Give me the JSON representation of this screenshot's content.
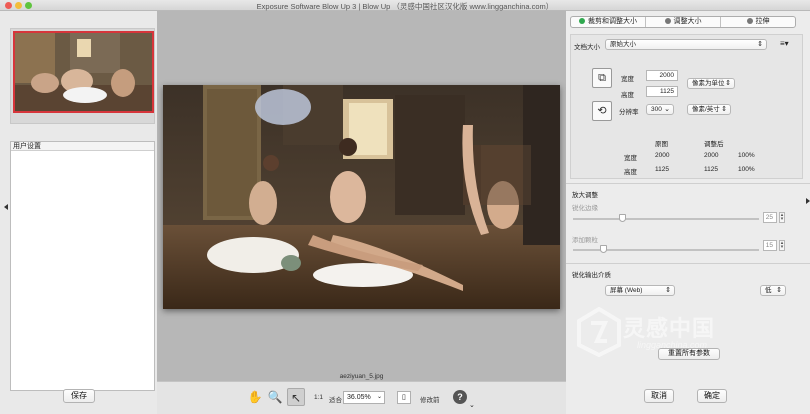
{
  "window": {
    "title": "Exposure Software Blow Up 3 | Blow Up （灵感中国社区汉化版 www.lingganchina.com）"
  },
  "left": {
    "preset_header": "用户设置",
    "save_button": "保存"
  },
  "center": {
    "filename": "aeziyuan_5.jpg",
    "zoom_one": "1:1",
    "fit_label": "适合",
    "zoom_value": "36.05%",
    "modified_label": "修改前",
    "help_label": "?"
  },
  "tabs": [
    {
      "label": "裁剪和调整大小"
    },
    {
      "label": "调整大小"
    },
    {
      "label": "拉伸"
    }
  ],
  "document": {
    "size_label": "文档大小",
    "size_value": "原始大小",
    "width_label": "宽度",
    "width_value": "2000",
    "height_label": "高度",
    "height_value": "1125",
    "unit_value": "像素为单位",
    "resolution_label": "分辨率",
    "resolution_value": "300",
    "resolution_unit": "像素/英寸",
    "table": {
      "headers": [
        "原图",
        "调整后"
      ],
      "rows": [
        {
          "label": "宽度",
          "original": "2000",
          "adjusted": "2000",
          "percent": "100%"
        },
        {
          "label": "高度",
          "original": "1125",
          "adjusted": "1125",
          "percent": "100%"
        }
      ]
    }
  },
  "enlarge": {
    "heading": "放大调整",
    "sharpen_label": "锐化边缘",
    "sharpen_value": "25",
    "grain_label": "添加颗粒",
    "grain_value": "15"
  },
  "output": {
    "heading": "锐化输出介质",
    "medium_value": "屏幕 (Web)",
    "level_value": "低",
    "reset_button": "重置所有参数"
  },
  "footer": {
    "cancel_button": "取消",
    "ok_button": "确定"
  },
  "watermark": {
    "brand": "灵感中国",
    "url": "lingganchina.com"
  }
}
